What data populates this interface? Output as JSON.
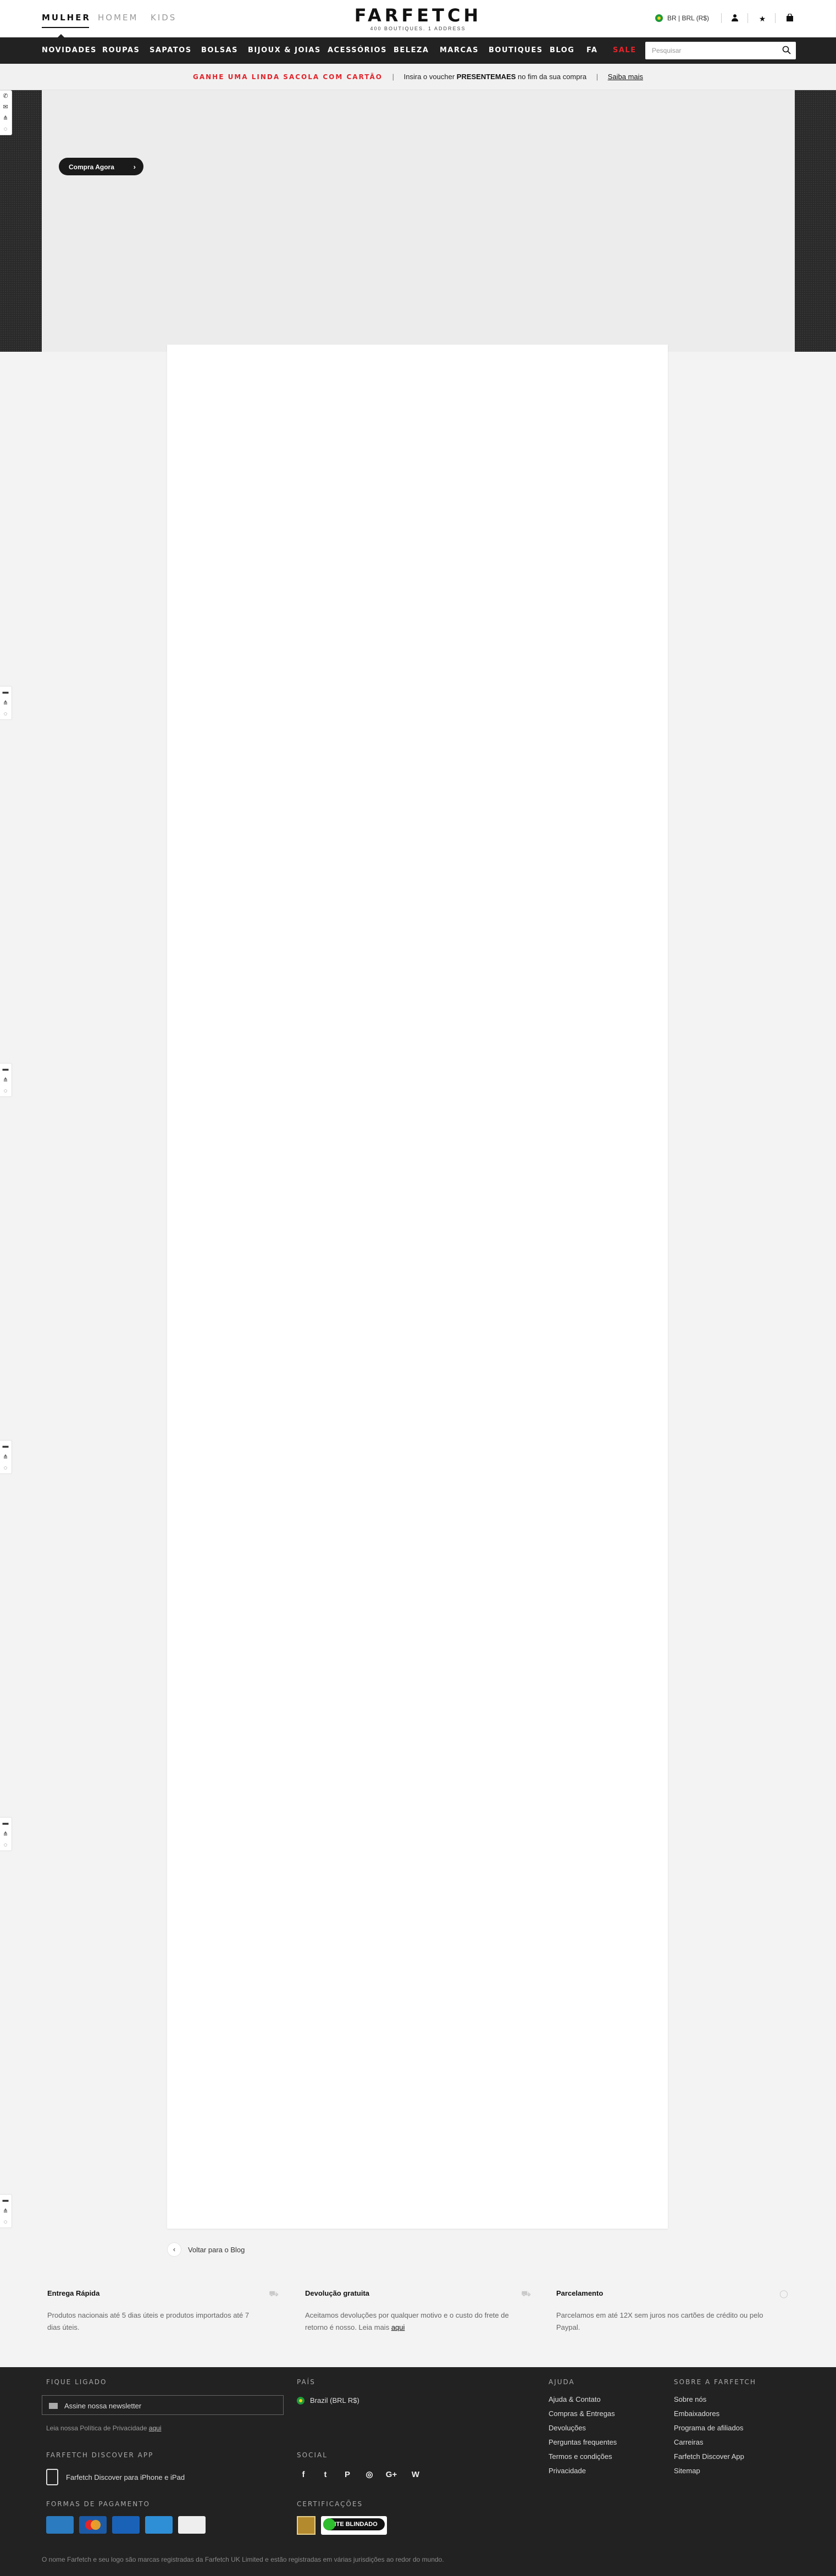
{
  "header": {
    "genders": [
      "MULHER",
      "HOMEM",
      "KIDS"
    ],
    "logo": "FARFETCH",
    "logo_tagline": "400 BOUTIQUES. 1 ADDRESS",
    "region": "BR | BRL (R$)"
  },
  "nav": {
    "items": [
      "NOVIDADES",
      "ROUPAS",
      "SAPATOS",
      "BOLSAS",
      "BIJOUX & JOIAS",
      "ACESSÓRIOS",
      "BELEZA",
      "MARCAS",
      "BOUTIQUES",
      "BLOG",
      "FA",
      "SALE"
    ],
    "search_placeholder": "Pesquisar"
  },
  "promo": {
    "headline": "GANHE UMA LINDA SACOLA COM CARTÃO",
    "text_before": "Insira o voucher",
    "code": "PRESENTEMAES",
    "text_after": "no fim da sua compra",
    "link": "Saiba mais"
  },
  "hero": {
    "cta": "Compra Agora"
  },
  "article": {
    "back_label": "Voltar para o Blog"
  },
  "benefits": [
    {
      "title": "Entrega Rápida",
      "text": "Produtos nacionais até 5 dias úteis e produtos importados até 7 dias úteis."
    },
    {
      "title": "Devolução gratuita",
      "text": "Aceitamos devoluções por qualquer motivo e o custo do frete de retorno é nosso. Leia mais",
      "link": "aqui"
    },
    {
      "title": "Parcelamento",
      "text": "Parcelamos em até 12X sem juros nos cartões de crédito ou pelo Paypal."
    }
  ],
  "footer": {
    "newsletter_heading": "FIQUE LIGADO",
    "newsletter_label": "Assine nossa newsletter",
    "privacy_text": "Leia nossa Política de Privacidade",
    "privacy_link": "aqui",
    "app_heading": "FARFETCH DISCOVER APP",
    "app_text": "Farfetch Discover para iPhone e iPad",
    "payment_heading": "FORMAS DE PAGAMENTO",
    "payment_methods": [
      "AMEX",
      "MASTERCARD",
      "VISA",
      "PAYPAL",
      "BOLETO"
    ],
    "country_heading": "PAÍS",
    "country": "Brazil (BRL R$)",
    "social_heading": "SOCIAL",
    "social_icons": [
      "facebook-icon",
      "twitter-icon",
      "pinterest-icon",
      "instagram-icon",
      "google-plus-icon",
      "weibo-icon"
    ],
    "social_glyphs": [
      "f",
      "t",
      "P",
      "◎",
      "G+",
      "W"
    ],
    "cert_heading": "CERTIFICAÇÕES",
    "cert_site_blindado": "SITE BLINDADO",
    "help_heading": "AJUDA",
    "help_links": [
      "Ajuda & Contato",
      "Compras & Entregas",
      "Devoluções",
      "Perguntas frequentes",
      "Termos e condições",
      "Privacidade"
    ],
    "about_heading": "SOBRE A FARFETCH",
    "about_links": [
      "Sobre nós",
      "Embaixadores",
      "Programa de afiliados",
      "Carreiras",
      "Farfetch Discover App",
      "Sitemap"
    ],
    "copyright": "O nome Farfetch e seu logo são marcas registradas da Farfetch UK Limited e estão registradas em várias jurisdições ao redor do mundo."
  },
  "colors": {
    "accent_red": "#e2242b",
    "nav_bg": "#222222",
    "footer_bg": "#222222"
  }
}
